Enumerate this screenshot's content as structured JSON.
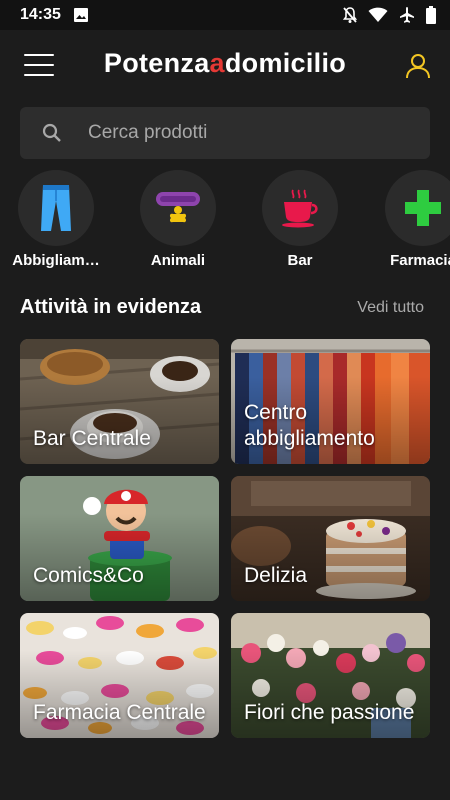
{
  "status_bar": {
    "time": "14:35",
    "icons": [
      "image-icon",
      "notifications-off-icon",
      "wifi-icon",
      "airplane-icon",
      "battery-icon"
    ]
  },
  "app_bar": {
    "logo_part1": "Potenza",
    "logo_part2": "a",
    "logo_part3": "domicilio",
    "accent_color": "#e53935",
    "user_icon_color": "#f3c623"
  },
  "search": {
    "placeholder": "Cerca prodotti"
  },
  "categories": [
    {
      "label": "Abbigliam…",
      "icon": "jeans-icon"
    },
    {
      "label": "Animali",
      "icon": "pet-collar-icon"
    },
    {
      "label": "Bar",
      "icon": "coffee-cup-icon"
    },
    {
      "label": "Farmacia",
      "icon": "pharmacy-cross-icon"
    }
  ],
  "featured": {
    "title": "Attività in evidenza",
    "see_all": "Vedi tutto",
    "shops": [
      {
        "name": "Bar Centrale"
      },
      {
        "name": "Centro abbigliamento"
      },
      {
        "name": "Comics&Co"
      },
      {
        "name": "Delizia"
      },
      {
        "name": "Farmacia Centrale"
      },
      {
        "name": "Fiori che passione"
      }
    ]
  }
}
